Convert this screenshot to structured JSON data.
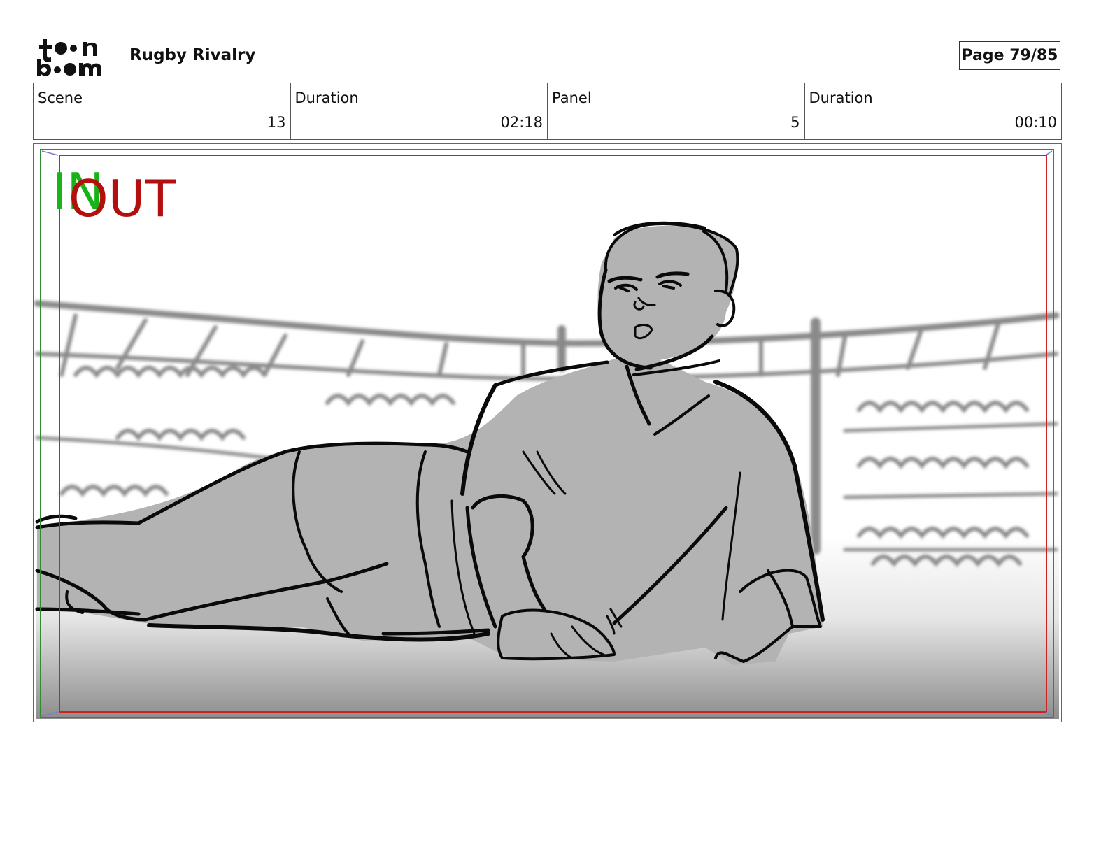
{
  "header": {
    "logo_top": "toon",
    "logo_bottom": "boom",
    "project_title": "Rugby Rivalry",
    "page_label": "Page 79/85"
  },
  "info": {
    "scene_label": "Scene",
    "scene_value": "13",
    "scene_duration_label": "Duration",
    "scene_duration_value": "02:18",
    "panel_label": "Panel",
    "panel_value": "5",
    "panel_duration_label": "Duration",
    "panel_duration_value": "00:10"
  },
  "panel": {
    "in_marker": "IN",
    "out_marker": "OUT",
    "colors": {
      "in": "#17b317",
      "out": "#b30f0f",
      "safe_green": "#2e8b2e",
      "safe_red": "#cc2222",
      "figure_fill": "#b3b3b3",
      "line": "#0a0a0a"
    }
  }
}
